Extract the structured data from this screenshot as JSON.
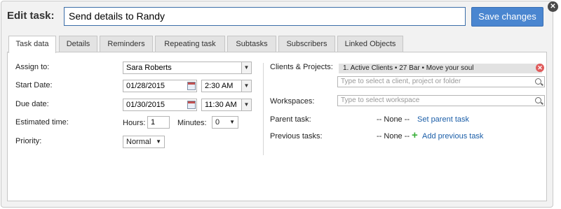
{
  "header": {
    "edit_label": "Edit task:",
    "task_title": "Send details to Randy",
    "save_label": "Save changes",
    "close_glyph": "✕"
  },
  "tabs": [
    {
      "label": "Task data",
      "active": true
    },
    {
      "label": "Details"
    },
    {
      "label": "Reminders"
    },
    {
      "label": "Repeating task"
    },
    {
      "label": "Subtasks"
    },
    {
      "label": "Subscribers"
    },
    {
      "label": "Linked Objects"
    }
  ],
  "left": {
    "assign_label": "Assign to:",
    "assign_value": "Sara Roberts",
    "start_label": "Start Date:",
    "start_date": "01/28/2015",
    "start_time": "2:30 AM",
    "due_label": "Due date:",
    "due_date": "01/30/2015",
    "due_time": "11:30 AM",
    "est_label": "Estimated time:",
    "hours_label": "Hours:",
    "hours_value": "1",
    "minutes_label": "Minutes:",
    "minutes_value": "0",
    "priority_label": "Priority:",
    "priority_value": "Normal"
  },
  "right": {
    "clients_label": "Clients & Projects:",
    "client_chip": "1. Active Clients • 27 Bar • Move your soul",
    "client_placeholder": "Type to select a client, project or folder",
    "workspaces_label": "Workspaces:",
    "workspace_placeholder": "Type to select workspace",
    "parent_label": "Parent task:",
    "parent_value": "-- None --",
    "parent_link": "Set parent task",
    "previous_label": "Previous tasks:",
    "previous_value": "-- None --",
    "previous_link": "Add previous task"
  }
}
